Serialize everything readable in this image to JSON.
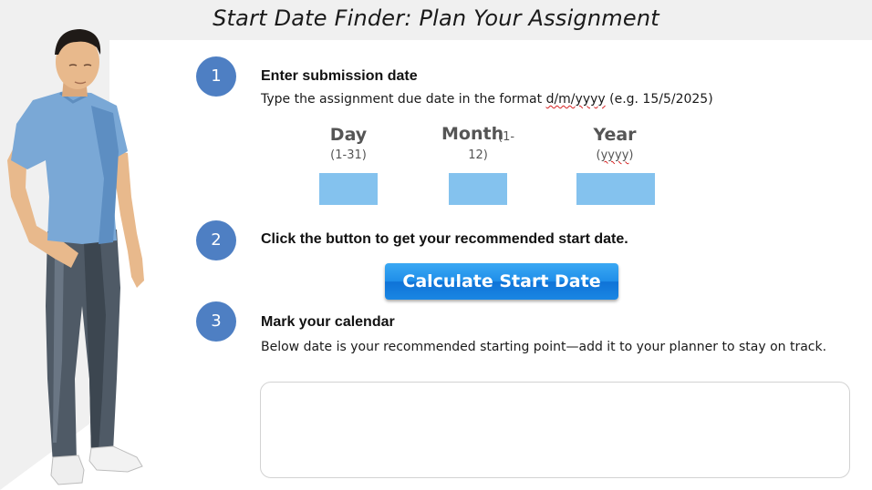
{
  "header": {
    "title": "Start Date Finder: Plan Your Assignment"
  },
  "steps": [
    {
      "number": "1",
      "heading": "Enter submission date",
      "text_before": "Type the assignment due date in the format ",
      "format_day_month": "d/m/",
      "format_year": "yyyy",
      "text_after": " (e.g. 15/5/2025)"
    },
    {
      "number": "2",
      "heading": "Click the button to get your recommended start date."
    },
    {
      "number": "3",
      "heading": "Mark your calendar",
      "text": "Below date is your recommended starting point—add it to your planner to stay on track."
    }
  ],
  "fields": {
    "day": {
      "label": "Day",
      "hint": "(1-31)",
      "value": ""
    },
    "month": {
      "label": "Month",
      "hint_line1": "(1-",
      "hint_line2": "12)",
      "value": ""
    },
    "year": {
      "label": "Year",
      "hint_open": "(",
      "hint_word": "yyyy",
      "hint_close": ")",
      "value": ""
    }
  },
  "button": {
    "label": "Calculate Start Date"
  },
  "result": {
    "value": ""
  },
  "colors": {
    "step_circle": "#4e7fc3",
    "input_fill": "#84c2ee",
    "button_blue": "#1f8ee9",
    "banner": "#f0f0f0"
  }
}
